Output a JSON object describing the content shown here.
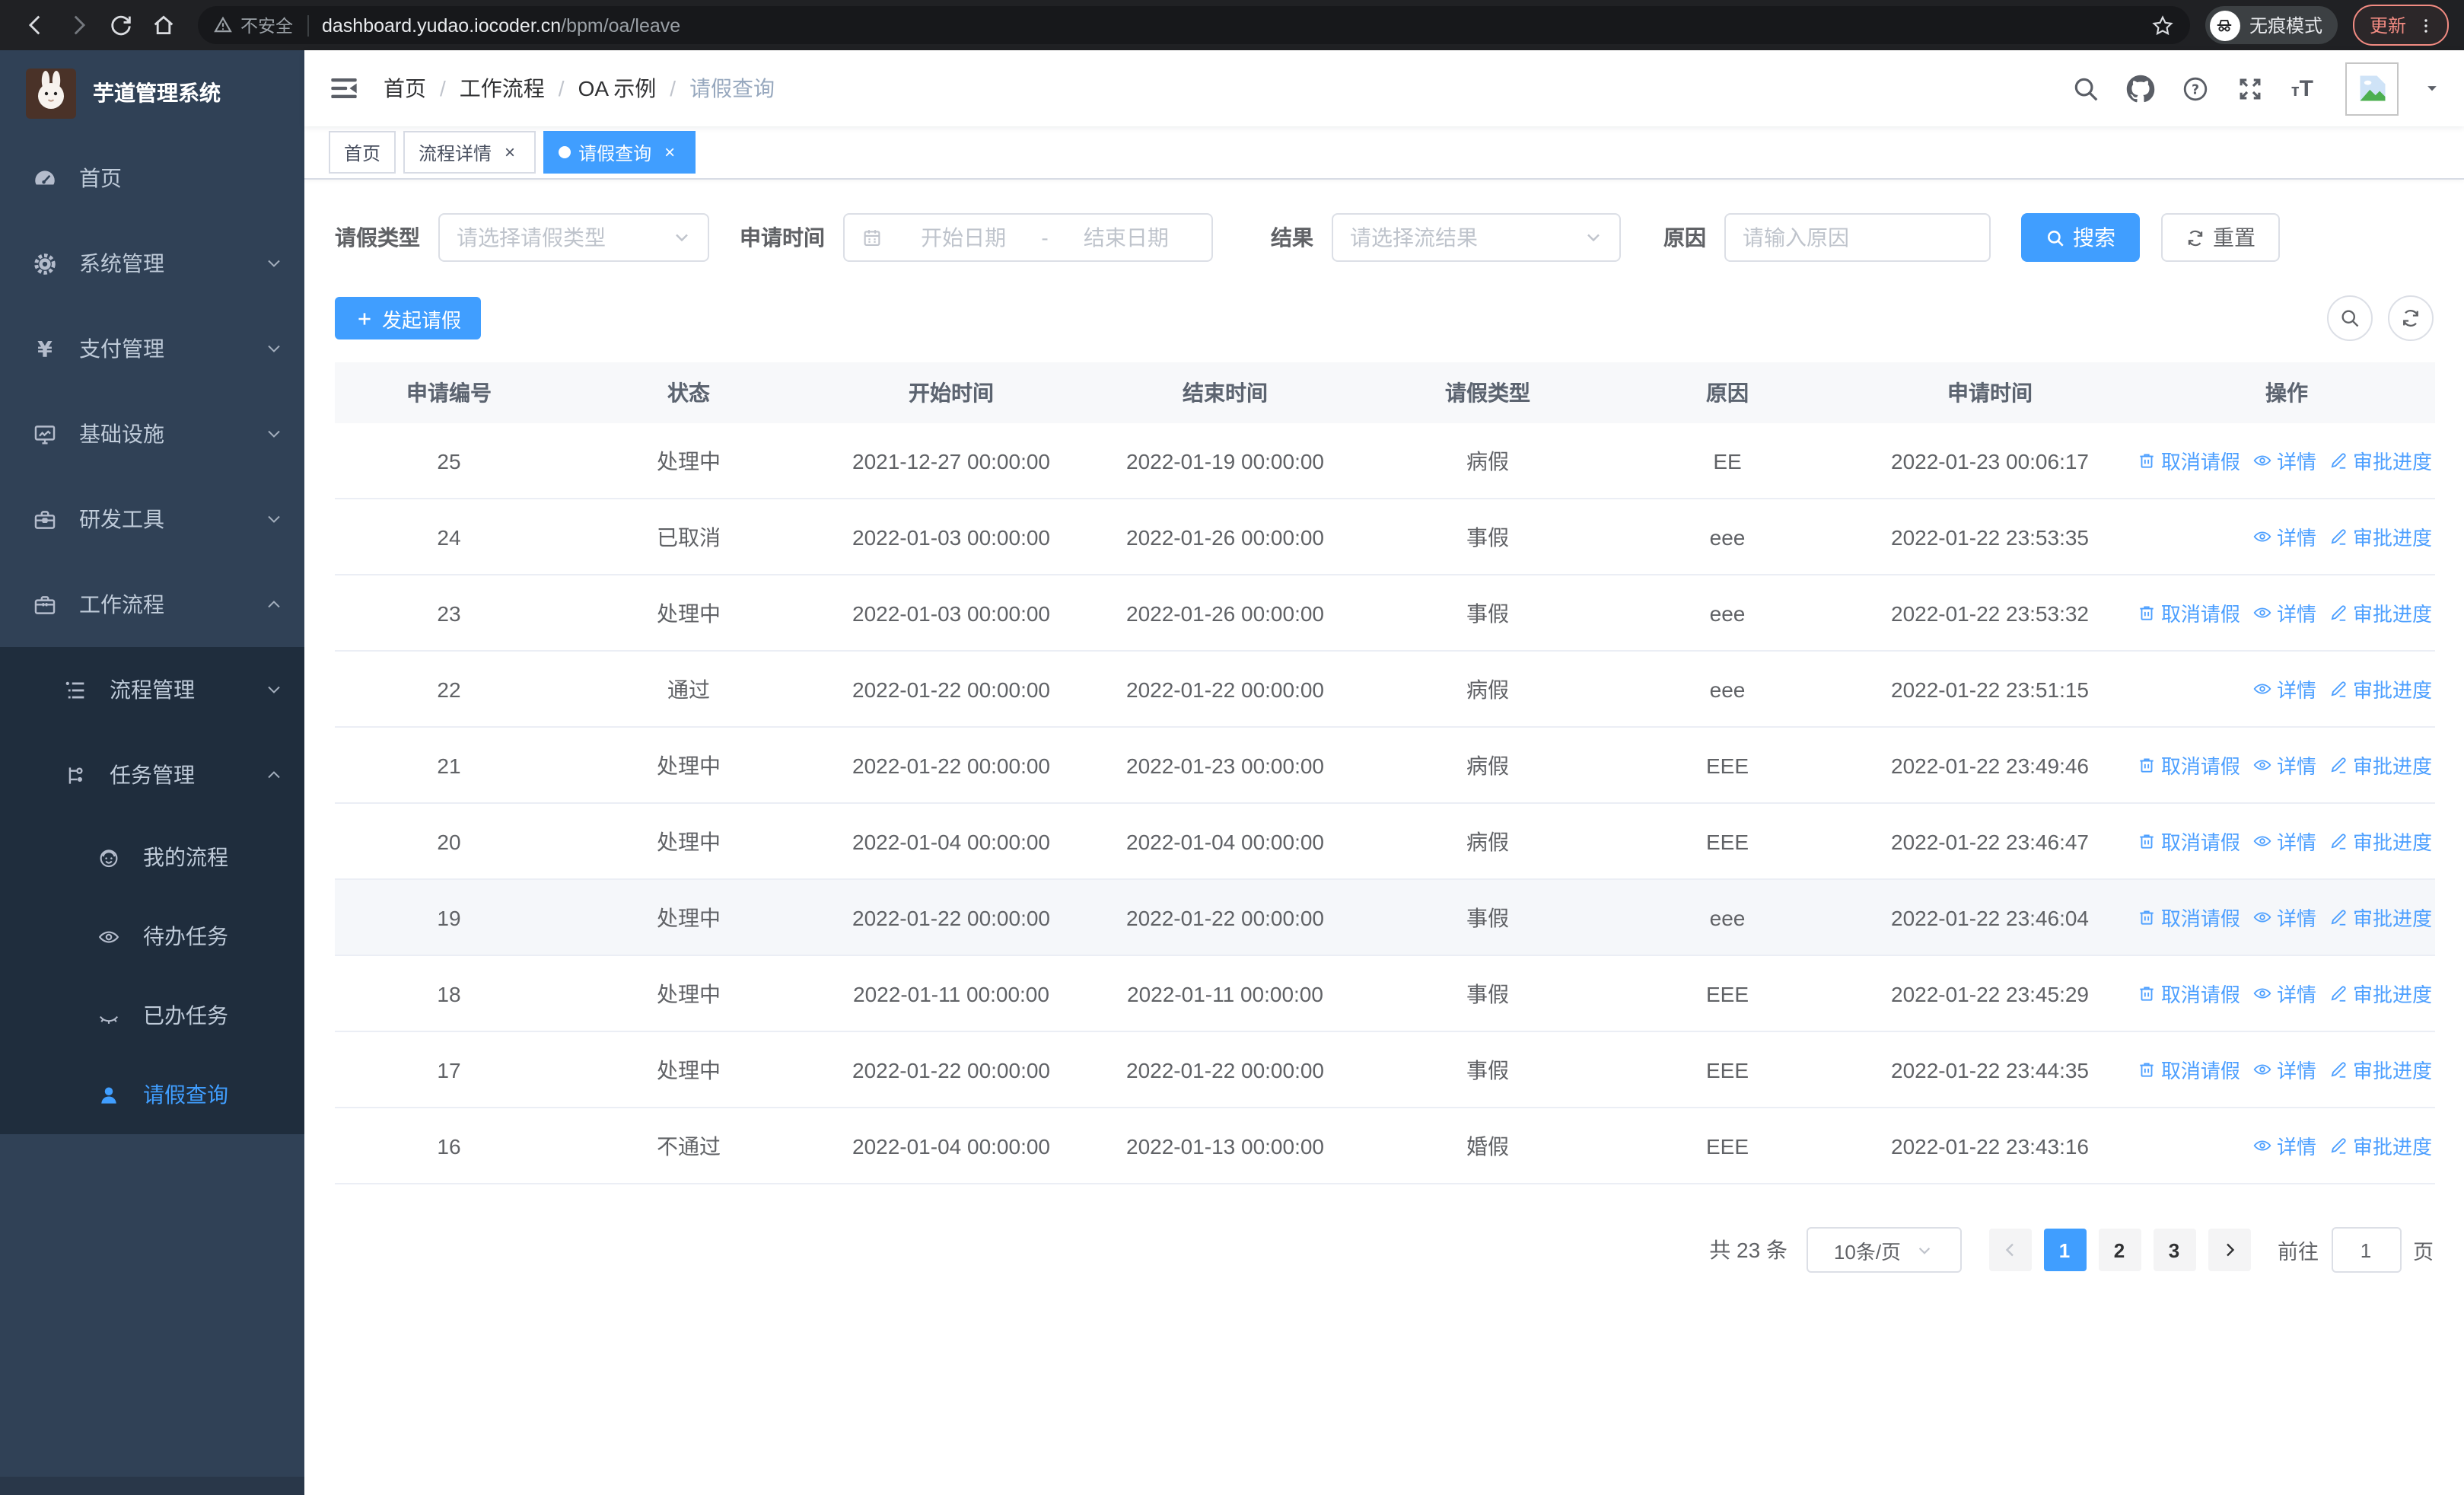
{
  "browser": {
    "security_label": "不安全",
    "url_host": "dashboard.yudao.iocoder.cn",
    "url_path": "/bpm/oa/leave",
    "incognito_label": "无痕模式",
    "update_label": "更新"
  },
  "sidebar": {
    "app_title": "芋道管理系统",
    "items": [
      {
        "key": "home",
        "label": "首页",
        "icon": "dashboard",
        "level": 1
      },
      {
        "key": "system-management",
        "label": "系统管理",
        "icon": "gear",
        "level": 1,
        "chevron": "down"
      },
      {
        "key": "payment-management",
        "label": "支付管理",
        "icon": "yen",
        "level": 1,
        "chevron": "down"
      },
      {
        "key": "infrastructure",
        "label": "基础设施",
        "icon": "monitor",
        "level": 1,
        "chevron": "down"
      },
      {
        "key": "dev-tools",
        "label": "研发工具",
        "icon": "toolbox",
        "level": 1,
        "chevron": "down"
      },
      {
        "key": "workflow",
        "label": "工作流程",
        "icon": "briefcase",
        "level": 1,
        "chevron": "up"
      },
      {
        "key": "process-management",
        "label": "流程管理",
        "icon": "list-tree",
        "level": 2,
        "dark": true,
        "chevron": "down"
      },
      {
        "key": "task-management",
        "label": "任务管理",
        "icon": "flow",
        "level": 2,
        "dark": true,
        "chevron": "up"
      },
      {
        "key": "my-process",
        "label": "我的流程",
        "icon": "user-face",
        "level": 3,
        "dark": true
      },
      {
        "key": "todo-tasks",
        "label": "待办任务",
        "icon": "eye",
        "level": 3,
        "dark": true
      },
      {
        "key": "done-tasks",
        "label": "已办任务",
        "icon": "eye-closed",
        "level": 3,
        "dark": true
      },
      {
        "key": "leave-query",
        "label": "请假查询",
        "icon": "person",
        "level": 3,
        "dark": true,
        "active": true
      }
    ]
  },
  "breadcrumb": [
    "首页",
    "工作流程",
    "OA 示例",
    "请假查询"
  ],
  "tabs": [
    {
      "key": "home",
      "label": "首页",
      "closable": false,
      "active": false
    },
    {
      "key": "process-detail",
      "label": "流程详情",
      "closable": true,
      "active": false
    },
    {
      "key": "leave-query",
      "label": "请假查询",
      "closable": true,
      "active": true
    }
  ],
  "filters": {
    "leave_type_label": "请假类型",
    "leave_type_placeholder": "请选择请假类型",
    "apply_time_label": "申请时间",
    "start_date_placeholder": "开始日期",
    "range_separator": "-",
    "end_date_placeholder": "结束日期",
    "result_label": "结果",
    "result_placeholder": "请选择流结果",
    "reason_label": "原因",
    "reason_placeholder": "请输入原因",
    "search_label": "搜索",
    "reset_label": "重置"
  },
  "toolbar": {
    "create_label": "发起请假"
  },
  "table": {
    "columns": [
      "申请编号",
      "状态",
      "开始时间",
      "结束时间",
      "请假类型",
      "原因",
      "申请时间",
      "操作"
    ],
    "action_labels": {
      "cancel": "取消请假",
      "detail": "详情",
      "progress": "审批进度"
    },
    "rows": [
      {
        "id": "25",
        "status": "处理中",
        "start": "2021-12-27 00:00:00",
        "end": "2022-01-19 00:00:00",
        "type": "病假",
        "reason": "EE",
        "applied": "2022-01-23 00:06:17",
        "cancellable": true,
        "highlight": false
      },
      {
        "id": "24",
        "status": "已取消",
        "start": "2022-01-03 00:00:00",
        "end": "2022-01-26 00:00:00",
        "type": "事假",
        "reason": "eee",
        "applied": "2022-01-22 23:53:35",
        "cancellable": false,
        "highlight": false
      },
      {
        "id": "23",
        "status": "处理中",
        "start": "2022-01-03 00:00:00",
        "end": "2022-01-26 00:00:00",
        "type": "事假",
        "reason": "eee",
        "applied": "2022-01-22 23:53:32",
        "cancellable": true,
        "highlight": false
      },
      {
        "id": "22",
        "status": "通过",
        "start": "2022-01-22 00:00:00",
        "end": "2022-01-22 00:00:00",
        "type": "病假",
        "reason": "eee",
        "applied": "2022-01-22 23:51:15",
        "cancellable": false,
        "highlight": false
      },
      {
        "id": "21",
        "status": "处理中",
        "start": "2022-01-22 00:00:00",
        "end": "2022-01-23 00:00:00",
        "type": "病假",
        "reason": "EEE",
        "applied": "2022-01-22 23:49:46",
        "cancellable": true,
        "highlight": false
      },
      {
        "id": "20",
        "status": "处理中",
        "start": "2022-01-04 00:00:00",
        "end": "2022-01-04 00:00:00",
        "type": "病假",
        "reason": "EEE",
        "applied": "2022-01-22 23:46:47",
        "cancellable": true,
        "highlight": false
      },
      {
        "id": "19",
        "status": "处理中",
        "start": "2022-01-22 00:00:00",
        "end": "2022-01-22 00:00:00",
        "type": "事假",
        "reason": "eee",
        "applied": "2022-01-22 23:46:04",
        "cancellable": true,
        "highlight": true
      },
      {
        "id": "18",
        "status": "处理中",
        "start": "2022-01-11 00:00:00",
        "end": "2022-01-11 00:00:00",
        "type": "事假",
        "reason": "EEE",
        "applied": "2022-01-22 23:45:29",
        "cancellable": true,
        "highlight": false
      },
      {
        "id": "17",
        "status": "处理中",
        "start": "2022-01-22 00:00:00",
        "end": "2022-01-22 00:00:00",
        "type": "事假",
        "reason": "EEE",
        "applied": "2022-01-22 23:44:35",
        "cancellable": true,
        "highlight": false
      },
      {
        "id": "16",
        "status": "不通过",
        "start": "2022-01-04 00:00:00",
        "end": "2022-01-13 00:00:00",
        "type": "婚假",
        "reason": "EEE",
        "applied": "2022-01-22 23:43:16",
        "cancellable": false,
        "highlight": false
      }
    ]
  },
  "pagination": {
    "total_label": "共 23 条",
    "page_size_label": "10条/页",
    "pages": [
      "1",
      "2",
      "3"
    ],
    "active_page": "1",
    "goto_label": "前往",
    "goto_value": "1",
    "page_unit_label": "页"
  },
  "colors": {
    "primary": "#409eff",
    "action_link": "#4c9fff",
    "sidebar_bg": "#304156",
    "submenu_bg": "#1f2d3d",
    "table_header_bg": "#f7f8fa",
    "update_accent": "#f28b82"
  }
}
